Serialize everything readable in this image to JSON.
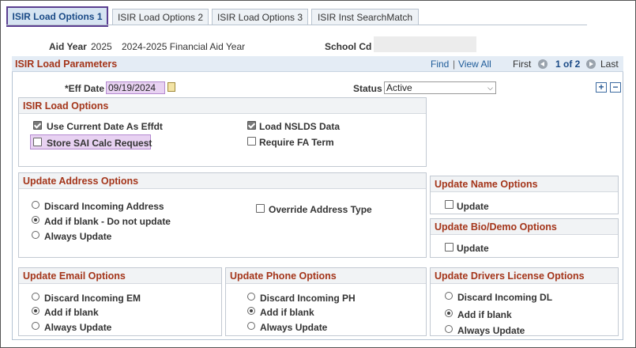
{
  "tabs": [
    {
      "label": "ISIR Load Options 1"
    },
    {
      "label": "ISIR Load Options 2"
    },
    {
      "label": "ISIR Load Options 3"
    },
    {
      "label": "ISIR Inst SearchMatch"
    }
  ],
  "header": {
    "aid_year_label": "Aid Year",
    "aid_year": "2025",
    "aid_year_desc": "2024-2025 Financial Aid Year",
    "school_cd_label": "School Cd"
  },
  "params": {
    "title": "ISIR Load Parameters",
    "find": "Find",
    "sep": "|",
    "view_all": "View All",
    "first": "First",
    "page_count": "1 of 2",
    "last": "Last",
    "eff_date_label": "*Eff Date",
    "eff_date": "09/19/2024",
    "status_label": "Status",
    "status": "Active",
    "add": "+",
    "remove": "−"
  },
  "load_options": {
    "title": "ISIR Load Options",
    "use_current_date": {
      "label": "Use Current Date As Effdt",
      "checked": true
    },
    "store_sai": {
      "label": "Store SAI Calc Request",
      "checked": false
    },
    "load_nslds": {
      "label": "Load NSLDS Data",
      "checked": true
    },
    "require_fa_term": {
      "label": "Require FA Term",
      "checked": false
    }
  },
  "address": {
    "title": "Update Address Options",
    "options": [
      "Discard Incoming Address",
      "Add if blank - Do not update",
      "Always Update"
    ],
    "selected": 1,
    "override_label": "Override Address Type"
  },
  "name": {
    "title": "Update Name Options",
    "update_label": "Update"
  },
  "biodemo": {
    "title": "Update Bio/Demo Options",
    "update_label": "Update"
  },
  "email": {
    "title": "Update Email Options",
    "options": [
      "Discard Incoming EM",
      "Add if blank",
      "Always Update"
    ],
    "selected": 1
  },
  "phone": {
    "title": "Update Phone Options",
    "options": [
      "Discard Incoming PH",
      "Add if blank",
      "Always Update"
    ],
    "selected": 1
  },
  "drivers": {
    "title": "Update Drivers License Options",
    "options": [
      "Discard Incoming DL",
      "Add if blank",
      "Always Update"
    ],
    "selected": 1
  },
  "colors": {
    "accent": "#5b3f91",
    "section_title": "#a4351a",
    "link": "#1f5c99",
    "highlight": "#e8d2f2"
  }
}
